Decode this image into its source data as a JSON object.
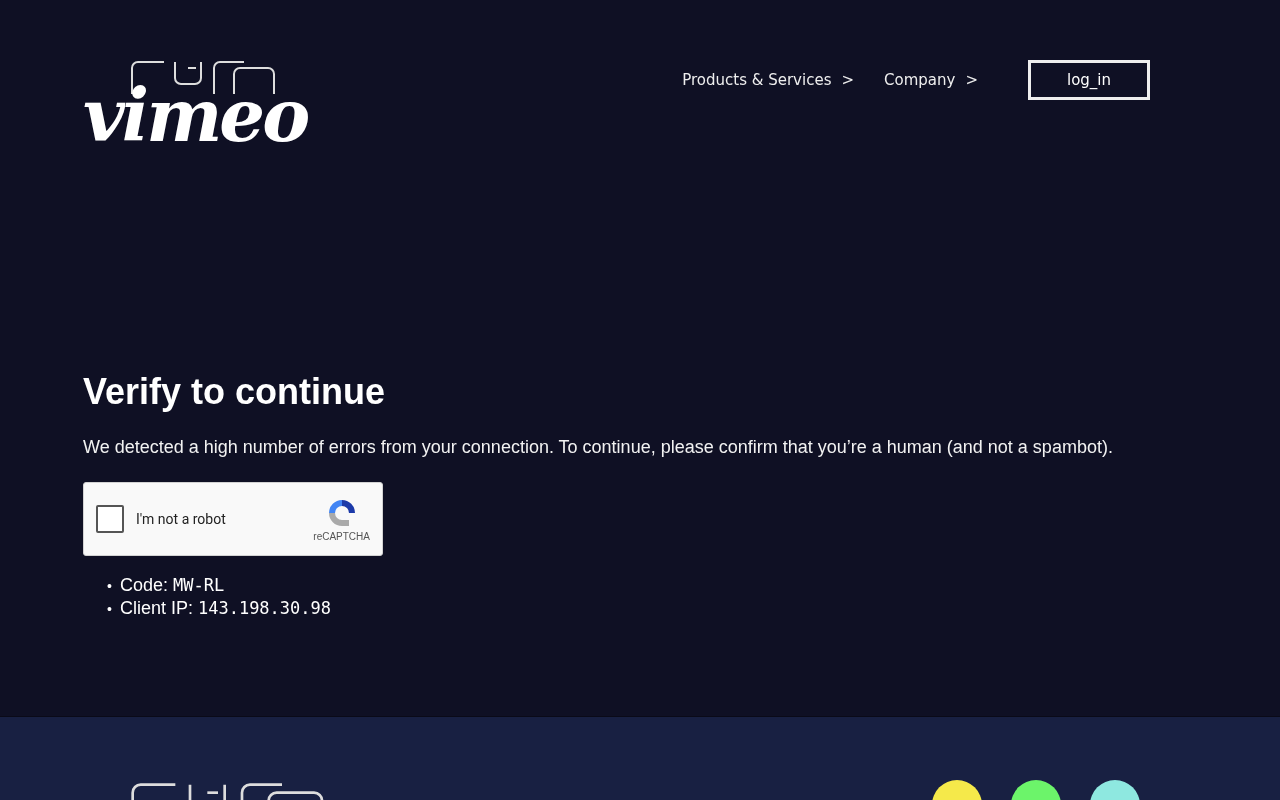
{
  "header": {
    "logo_text": "vimeo",
    "nav": [
      {
        "label": "Products & Services",
        "caret": ">"
      },
      {
        "label": "Company",
        "caret": ">"
      }
    ],
    "login_button": "log_in"
  },
  "main": {
    "title": "Verify to continue",
    "message": "We detected a high number of errors from your connection. To continue, please confirm that you’re a human (and not a spambot).",
    "captcha": {
      "label": "I'm not a robot",
      "checked": false,
      "brand": "reCAPTCHA"
    },
    "details": [
      {
        "bullet": "•",
        "label": "Code:",
        "value": "MW-RL"
      },
      {
        "bullet": "•",
        "label": "Client IP:",
        "value": "143.198.30.98"
      }
    ]
  },
  "footer": {
    "social": [
      {
        "color": "#f5e94a"
      },
      {
        "color": "#6cf46a"
      },
      {
        "color": "#8ee8e0"
      }
    ]
  }
}
